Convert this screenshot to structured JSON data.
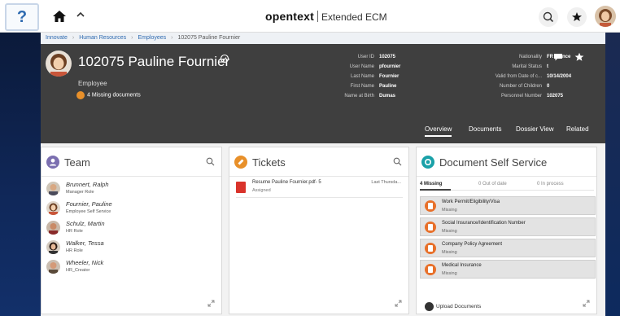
{
  "topbar": {
    "help_label": "?",
    "brand": "opentext",
    "product": "Extended ECM"
  },
  "breadcrumb": [
    "Innovate",
    "Human Resources",
    "Employees",
    "102075 Pauline Fournier"
  ],
  "header": {
    "title": "102075 Pauline Fournier",
    "role": "Employee",
    "missing_docs": "4 Missing documents",
    "fields_left": [
      {
        "label": "User ID",
        "value": "102075"
      },
      {
        "label": "User Name",
        "value": "pfournier"
      },
      {
        "label": "Last Name",
        "value": "Fournier"
      },
      {
        "label": "First Name",
        "value": "Pauline"
      },
      {
        "label": "Name at Birth",
        "value": "Dumas"
      }
    ],
    "fields_right": [
      {
        "label": "Nationality",
        "value": "FR France"
      },
      {
        "label": "Marital Status",
        "value": "t"
      },
      {
        "label": "Valid from Date of c...",
        "value": "10/14/2004"
      },
      {
        "label": "Number of Children",
        "value": "0"
      },
      {
        "label": "Personnel Number",
        "value": "102075"
      }
    ],
    "tabs": [
      "Overview",
      "Documents",
      "Dossier View",
      "Related"
    ]
  },
  "team": {
    "title": "Team",
    "members": [
      {
        "name": "Brunnert, Ralph",
        "role": "Manager Role"
      },
      {
        "name": "Fournier, Pauline",
        "role": "Employee Self Service"
      },
      {
        "name": "Schulz, Martin",
        "role": "HR Role"
      },
      {
        "name": "Walker, Tessa",
        "role": "HR Role"
      },
      {
        "name": "Wheeler, Nick",
        "role": "HR_Creator"
      }
    ]
  },
  "tickets": {
    "title": "Tickets",
    "items": [
      {
        "name": "Resume Pauline Fournier.pdf- 5",
        "status": "Assigned",
        "date": "Last Thursda..."
      }
    ]
  },
  "dss": {
    "title": "Document Self Service",
    "counts": {
      "missing": "4 Missing",
      "out_of_date": "0 Out of date",
      "in_process": "0 In process"
    },
    "documents": [
      {
        "name": "Work Permit/Eligibility/Visa",
        "status": "Missing"
      },
      {
        "name": "Social Insurance/Identification Number",
        "status": "Missing"
      },
      {
        "name": "Company Policy Agreement",
        "status": "Missing"
      },
      {
        "name": "Medical Insurance",
        "status": "Missing"
      }
    ],
    "upload_label": "Upload Documents"
  },
  "colors": {
    "header_bg": "#3f3f3f",
    "accent_blue": "#2e6ab0",
    "missing_orange": "#e8702a",
    "team_icon": "#7b6fb0",
    "tickets_icon": "#e8902a",
    "dss_icon": "#1aa1a8",
    "pdf_red": "#d9332b"
  },
  "icons": [
    "help-icon",
    "home-icon",
    "chevron-up-icon",
    "search-icon",
    "star-icon",
    "chat-icon",
    "expand-icon",
    "pdf-icon",
    "upload-icon",
    "missing-document-icon"
  ]
}
